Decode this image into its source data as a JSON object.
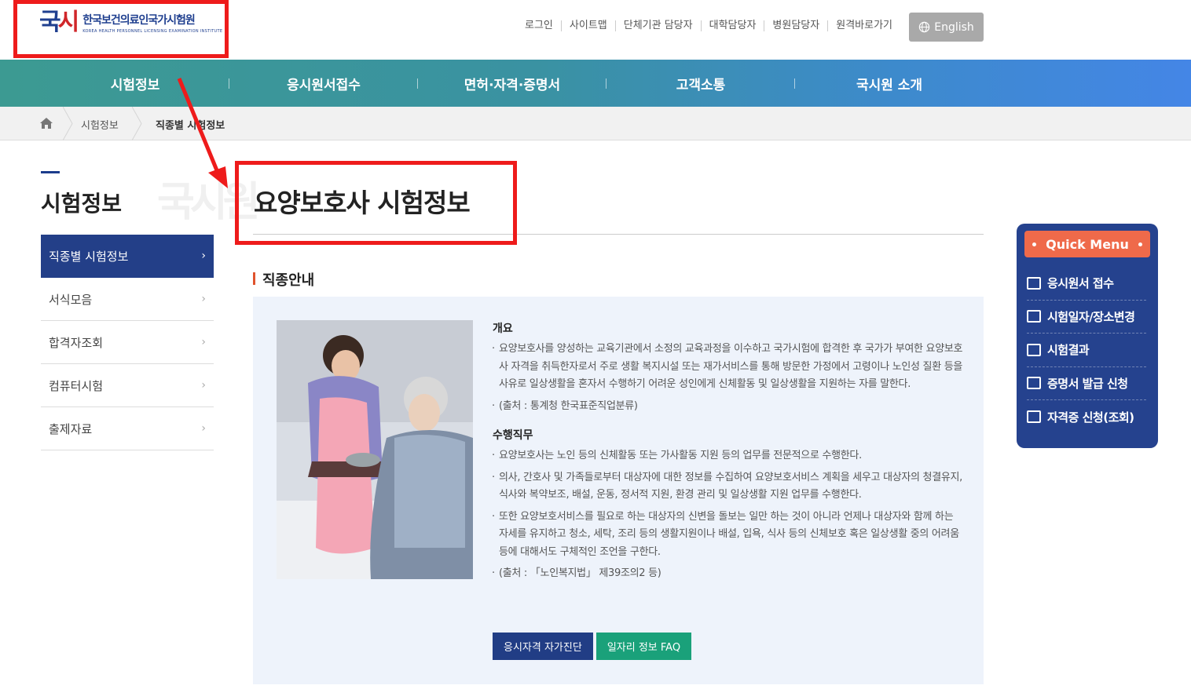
{
  "header": {
    "logo_mark": "국시원",
    "logo_kr": "한국보건의료인국가시험원",
    "logo_en": "KOREA HEALTH PERSONNEL LICENSING EXAMINATION INSTITUTE",
    "util_links": [
      "로그인",
      "사이트맵",
      "단체기관 담당자",
      "대학담당자",
      "병원담당자",
      "원격바로가기"
    ],
    "lang_button": "English"
  },
  "gnb": [
    "시험정보",
    "응시원서접수",
    "면허·자격·증명서",
    "고객소통",
    "국시원 소개"
  ],
  "breadcrumb": [
    "시험정보",
    "직종별 시험정보"
  ],
  "lnb": {
    "title": "시험정보",
    "watermark": "국시원",
    "items": [
      "직종별 시험정보",
      "서식모음",
      "합격자조회",
      "컴퓨터시험",
      "출제자료"
    ]
  },
  "main": {
    "title": "요양보호사 시험정보",
    "section": "직종안내",
    "overview_head": "개요",
    "overview": [
      "요양보호사를 양성하는 교육기관에서 소정의 교육과정을 이수하고 국가시험에 합격한 후 국가가 부여한 요양보호사 자격을 취득한자로서 주로 생활 복지시설 또는 재가서비스를 통해 방문한 가정에서 고령이나 노인성 질환 등을 사유로 일상생활을 혼자서 수행하기 어려운 성인에게 신체활동 및 일상생활을 지원하는 자를 말한다.",
      "(출처 : 통계청 한국표준직업분류)"
    ],
    "duty_head": "수행직무",
    "duty": [
      "요양보호사는 노인 등의 신체활동 또는 가사활동 지원 등의 업무를 전문적으로 수행한다.",
      "의사, 간호사 및 가족들로부터 대상자에 대한 정보를 수집하여 요양보호서비스 계획을 세우고 대상자의 청결유지, 식사와 복약보조, 배설, 운동, 정서적 지원, 환경 관리 및 일상생활 지원 업무를 수행한다.",
      "또한 요양보호서비스를 필요로 하는 대상자의 신변을 돌보는 일만 하는 것이 아니라 언제나 대상자와 함께 하는 자세를 유지하고 청소, 세탁, 조리 등의 생활지원이나 배설, 입욕, 식사 등의 신체보호 혹은 일상생활 중의 어려움 등에 대해서도 구체적인 조언을 구한다.",
      "(출처 : 「노인복지법」 제39조의2 등)"
    ],
    "buttons": [
      "응시자격 자가진단",
      "일자리 정보 FAQ"
    ]
  },
  "quick_menu": {
    "title": "Quick Menu",
    "items": [
      "응시원서 접수",
      "시험일자/장소변경",
      "시험결과",
      "증명서 발급 신청",
      "자격증 신청(조회)"
    ]
  },
  "colors": {
    "annotation": "#ee1b1b",
    "navy": "#233f88",
    "accent": "#ef6a4a",
    "teal": "#1aa17a"
  }
}
